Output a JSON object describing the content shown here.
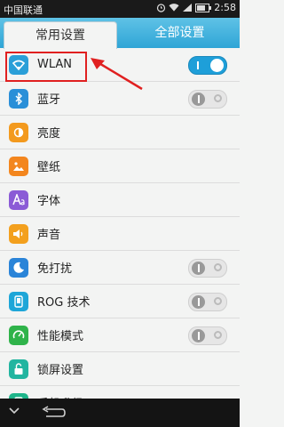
{
  "status_bar": {
    "carrier": "中国联通",
    "time": "2:58",
    "icons": [
      "alarm-icon",
      "wifi-icon",
      "signal-icon",
      "battery-icon"
    ]
  },
  "tabs": [
    {
      "label": "常用设置",
      "active": true
    },
    {
      "label": "全部设置",
      "active": false
    }
  ],
  "settings": [
    {
      "label": "WLAN",
      "icon": "wifi-icon",
      "color": "#2a9fd8",
      "toggle": "on"
    },
    {
      "label": "蓝牙",
      "icon": "bluetooth-icon",
      "color": "#2a8fd8",
      "toggle": "off"
    },
    {
      "label": "亮度",
      "icon": "brightness-icon",
      "color": "#f39a1e",
      "toggle": null
    },
    {
      "label": "壁纸",
      "icon": "wallpaper-icon",
      "color": "#f3861e",
      "toggle": null
    },
    {
      "label": "字体",
      "icon": "font-icon",
      "color": "#8b5bd6",
      "toggle": null
    },
    {
      "label": "声音",
      "icon": "sound-icon",
      "color": "#f3a01e",
      "toggle": null
    },
    {
      "label": "免打扰",
      "icon": "moon-icon",
      "color": "#2a84d8",
      "toggle": "off"
    },
    {
      "label": "ROG 技术",
      "icon": "rog-icon",
      "color": "#1ea6d8",
      "toggle": "off"
    },
    {
      "label": "性能模式",
      "icon": "performance-icon",
      "color": "#2fb34a",
      "toggle": "off"
    },
    {
      "label": "锁屏设置",
      "icon": "lock-icon",
      "color": "#22b5a0",
      "toggle": null
    },
    {
      "label": "手机升级",
      "icon": "upgrade-icon",
      "color": "#1eb58a",
      "toggle": null
    }
  ],
  "annotation": {
    "color": "#e02020"
  },
  "colors": {
    "accent": "#2fa5d6",
    "background": "#f3f4f3"
  }
}
